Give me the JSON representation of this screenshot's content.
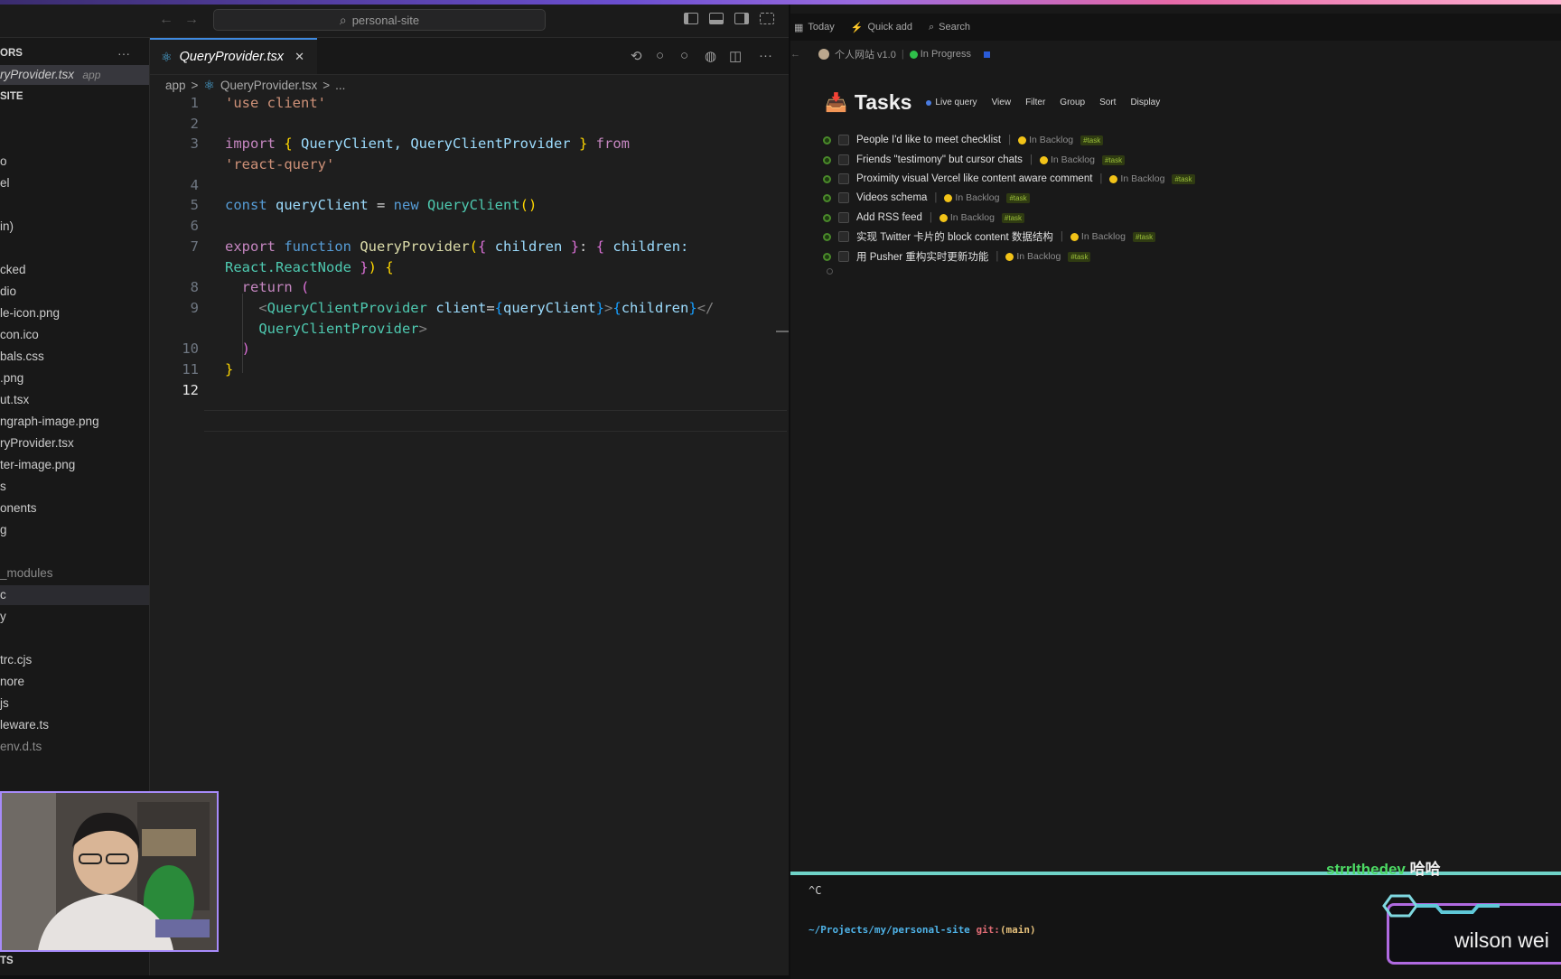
{
  "editor": {
    "search": "personal-site",
    "explorer_more": "···",
    "tab": {
      "label": "QueryProvider.tsx",
      "close": "✕",
      "icon": "⚛"
    },
    "breadcrumb": {
      "folder": "app",
      "sep": ">",
      "file": "QueryProvider.tsx",
      "more": "..."
    },
    "tab_tools": [
      "⟲",
      "○",
      "○",
      "◍",
      "◫",
      "···"
    ]
  },
  "sidebar": {
    "items": [
      {
        "text": "ORS",
        "kind": "head"
      },
      {
        "text": "ryProvider.tsx",
        "suffix": "app",
        "kind": "selected"
      },
      {
        "text": "SITE",
        "kind": "head"
      },
      {
        "text": "",
        "kind": "normal"
      },
      {
        "text": "",
        "kind": "normal"
      },
      {
        "text": "o",
        "kind": "normal"
      },
      {
        "text": "el",
        "kind": "normal"
      },
      {
        "text": "",
        "kind": "normal"
      },
      {
        "text": "in)",
        "kind": "normal"
      },
      {
        "text": "",
        "kind": "normal"
      },
      {
        "text": "cked",
        "kind": "normal"
      },
      {
        "text": "dio",
        "kind": "normal"
      },
      {
        "text": "le-icon.png",
        "kind": "normal"
      },
      {
        "text": "con.ico",
        "kind": "normal"
      },
      {
        "text": "bals.css",
        "kind": "normal"
      },
      {
        "text": ".png",
        "kind": "normal"
      },
      {
        "text": "ut.tsx",
        "kind": "normal"
      },
      {
        "text": "ngraph-image.png",
        "kind": "normal"
      },
      {
        "text": "ryProvider.tsx",
        "kind": "normal"
      },
      {
        "text": "ter-image.png",
        "kind": "normal"
      },
      {
        "text": "s",
        "kind": "normal"
      },
      {
        "text": "onents",
        "kind": "normal"
      },
      {
        "text": "g",
        "kind": "normal"
      },
      {
        "text": "",
        "kind": "normal"
      },
      {
        "text": "_modules",
        "kind": "dim"
      },
      {
        "text": "c",
        "kind": "highlight"
      },
      {
        "text": "y",
        "kind": "normal"
      },
      {
        "text": "",
        "kind": "normal"
      },
      {
        "text": "trc.cjs",
        "kind": "normal"
      },
      {
        "text": "nore",
        "kind": "normal"
      },
      {
        "text": "js",
        "kind": "normal"
      },
      {
        "text": "leware.ts",
        "kind": "normal"
      },
      {
        "text": "env.d.ts",
        "kind": "dim"
      }
    ],
    "bottom": "TS"
  },
  "code": {
    "line_numbers": [
      "1",
      "2",
      "3",
      "4",
      "5",
      "6",
      "7",
      "8",
      "9",
      "10",
      "11",
      "12"
    ],
    "l1": "'use client'",
    "l3_import": "import",
    "l3_b1": "{",
    "l3_names": " QueryClient, QueryClientProvider ",
    "l3_b2": "}",
    "l3_from": "from",
    "l3b": "'react-query'",
    "l5_const": "const",
    "l5_var": "queryClient",
    "l5_eq": " = ",
    "l5_new": "new",
    "l5_cls": "QueryClient",
    "l5_paren": "()",
    "l7_export": "export",
    "l7_function": "function",
    "l7_fn": "QueryProvider",
    "l7_po": "(",
    "l7_bo": "{",
    "l7_children": " children ",
    "l7_bc": "}",
    "l7_colon": ": ",
    "l7_bo2": "{",
    "l7_children2": " children:",
    "l7b_type": "React.ReactNode",
    "l7b_bc": " }",
    "l7b_pc": ")",
    "l7b_bo": " {",
    "l8_return": "return",
    "l8_paren": " (",
    "l9_open": "<",
    "l9_tag": "QueryClientProvider",
    "l9_attr": " client",
    "l9_eq": "=",
    "l9_expr1o": "{",
    "l9_qc": "queryClient",
    "l9_expr1c": "}",
    "l9_gt": ">",
    "l9_expr2o": "{",
    "l9_ch": "children",
    "l9_expr2c": "}",
    "l9_close": "</",
    "l9b_tag": "QueryClientProvider",
    "l9b_gt": ">",
    "l10": ")",
    "l11": "}"
  },
  "tasks": {
    "topbar": {
      "today": "Today",
      "quick_add": "Quick add",
      "search": "Search",
      "today_icon": "▦",
      "quick_icon": "⚡",
      "search_icon": "⌕"
    },
    "back": "←",
    "project": {
      "name": "个人网站 v1.0",
      "status": "In Progress",
      "status_color": "#2fbf4a"
    },
    "title": "Tasks",
    "title_icon": "📥",
    "header_options": {
      "live_query": "Live query",
      "view": "View",
      "filter": "Filter",
      "group": "Group",
      "sort": "Sort",
      "display": "Display"
    },
    "status_color": "#f2c318",
    "rows": [
      {
        "title": "People I'd like to meet checklist",
        "status": "In Backlog",
        "tag": "#task"
      },
      {
        "title": "Friends \"testimony\" but cursor chats",
        "status": "In Backlog",
        "tag": "#task"
      },
      {
        "title": "Proximity visual Vercel like content aware comment",
        "status": "In Backlog",
        "tag": "#task"
      },
      {
        "title": "Videos schema",
        "status": "In Backlog",
        "tag": "#task"
      },
      {
        "title": "Add RSS feed",
        "status": "In Backlog",
        "tag": "#task"
      },
      {
        "title": "实现 Twitter 卡片的 block content 数据结构",
        "status": "In Backlog",
        "tag": "#task"
      },
      {
        "title": "用 Pusher 重构实时更新功能",
        "status": "In Backlog",
        "tag": "#task"
      }
    ]
  },
  "terminal": {
    "ctrl_c": "^C",
    "path": "~/Projects/my/personal-site",
    "git": "git:",
    "branch": "(main)"
  },
  "stream": {
    "chat_user": "strrlthedev",
    "chat_msg": "哈哈",
    "name_banner": "wilson wei"
  }
}
